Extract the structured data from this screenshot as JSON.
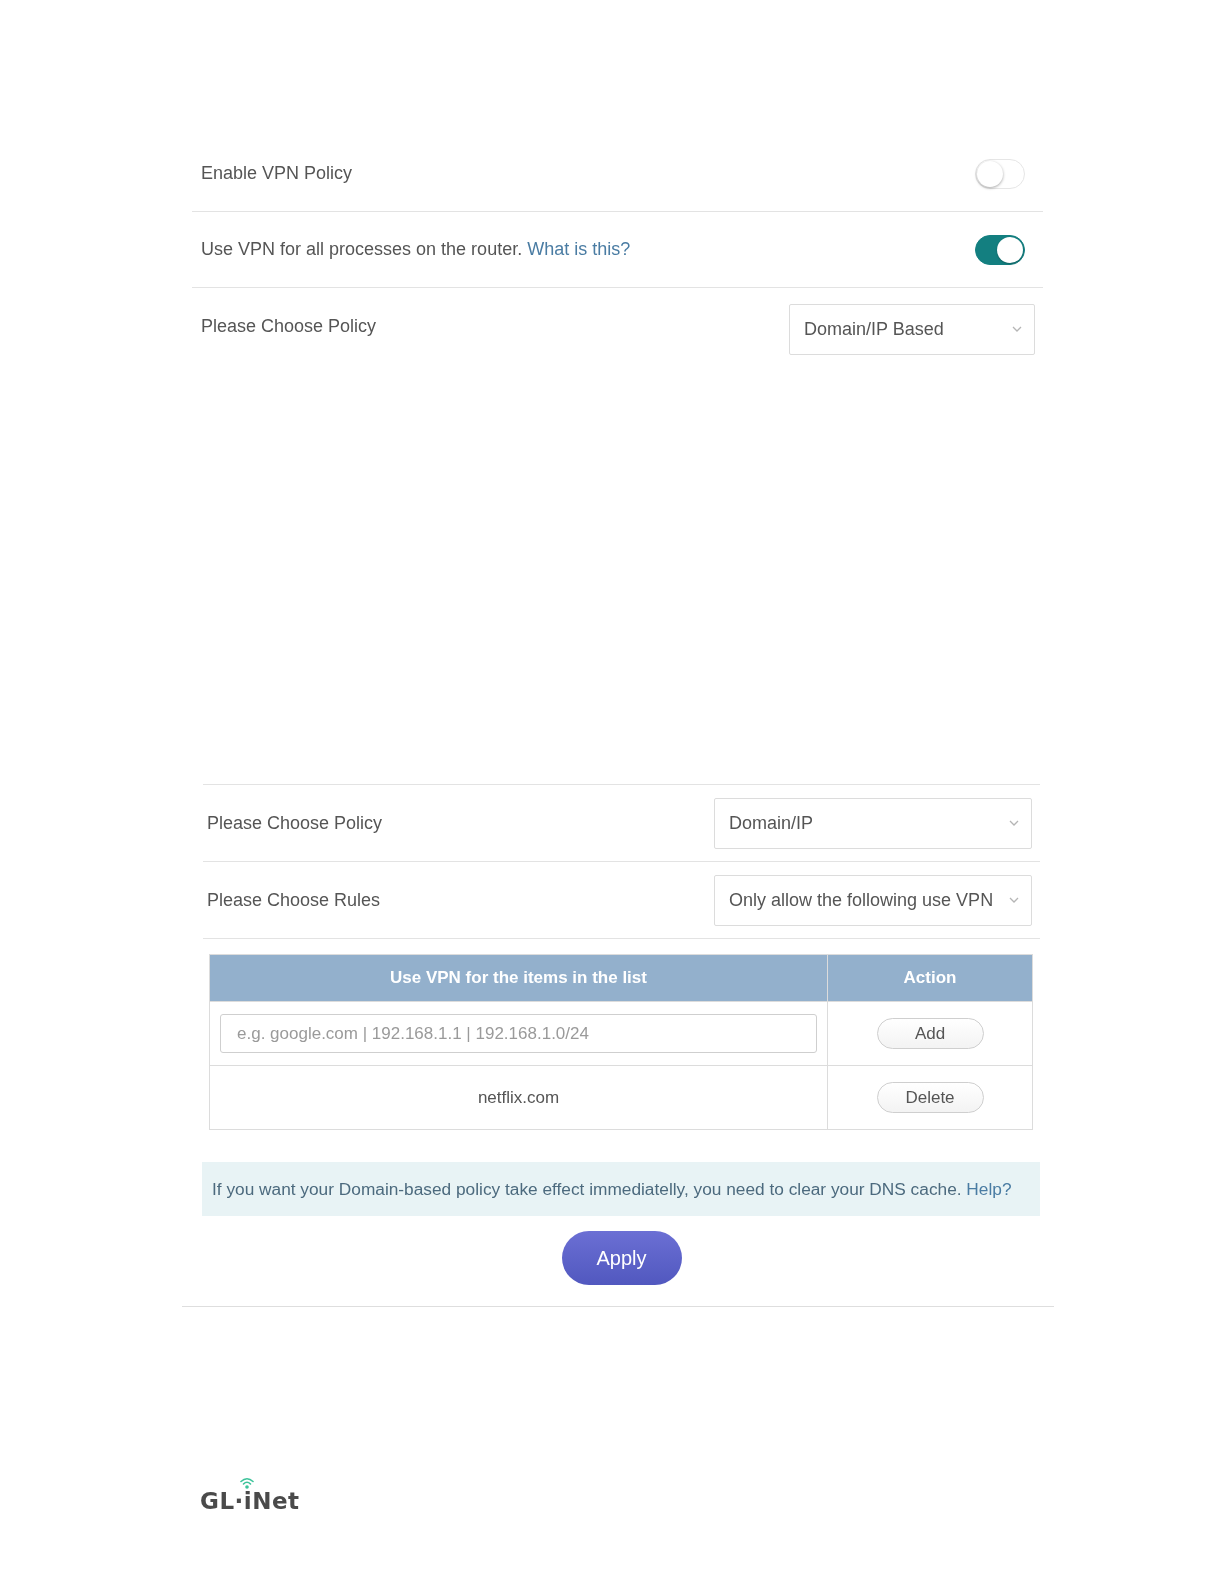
{
  "top_panel": {
    "rows": [
      {
        "kind": "toggle",
        "label": "Enable VPN Policy",
        "on": false
      },
      {
        "kind": "toggle",
        "label": "Use VPN for all processes on the router.",
        "link": "What is this?",
        "on": true
      },
      {
        "kind": "select",
        "label": "Please Choose Policy",
        "value": "Domain/IP Based"
      }
    ]
  },
  "bottom_panel": {
    "rows": [
      {
        "kind": "select",
        "label": "Please Choose Policy",
        "value": "Domain/IP"
      },
      {
        "kind": "select",
        "label": "Please Choose Rules",
        "value": "Only allow the following use VPN"
      }
    ],
    "table": {
      "columns": [
        "Use VPN for the items in the list",
        "Action"
      ],
      "input": {
        "placeholder": "e.g. google.com | 192.168.1.1 | 192.168.1.0/24",
        "button": "Add"
      },
      "rows": [
        {
          "item": "netflix.com",
          "button": "Delete"
        }
      ]
    },
    "notice": {
      "text": "If you want your Domain-based policy take effect immediatelly, you need to clear your DNS cache.",
      "link": "Help?"
    },
    "apply_button": "Apply"
  },
  "footer": {
    "logo": "GL·iNet"
  }
}
